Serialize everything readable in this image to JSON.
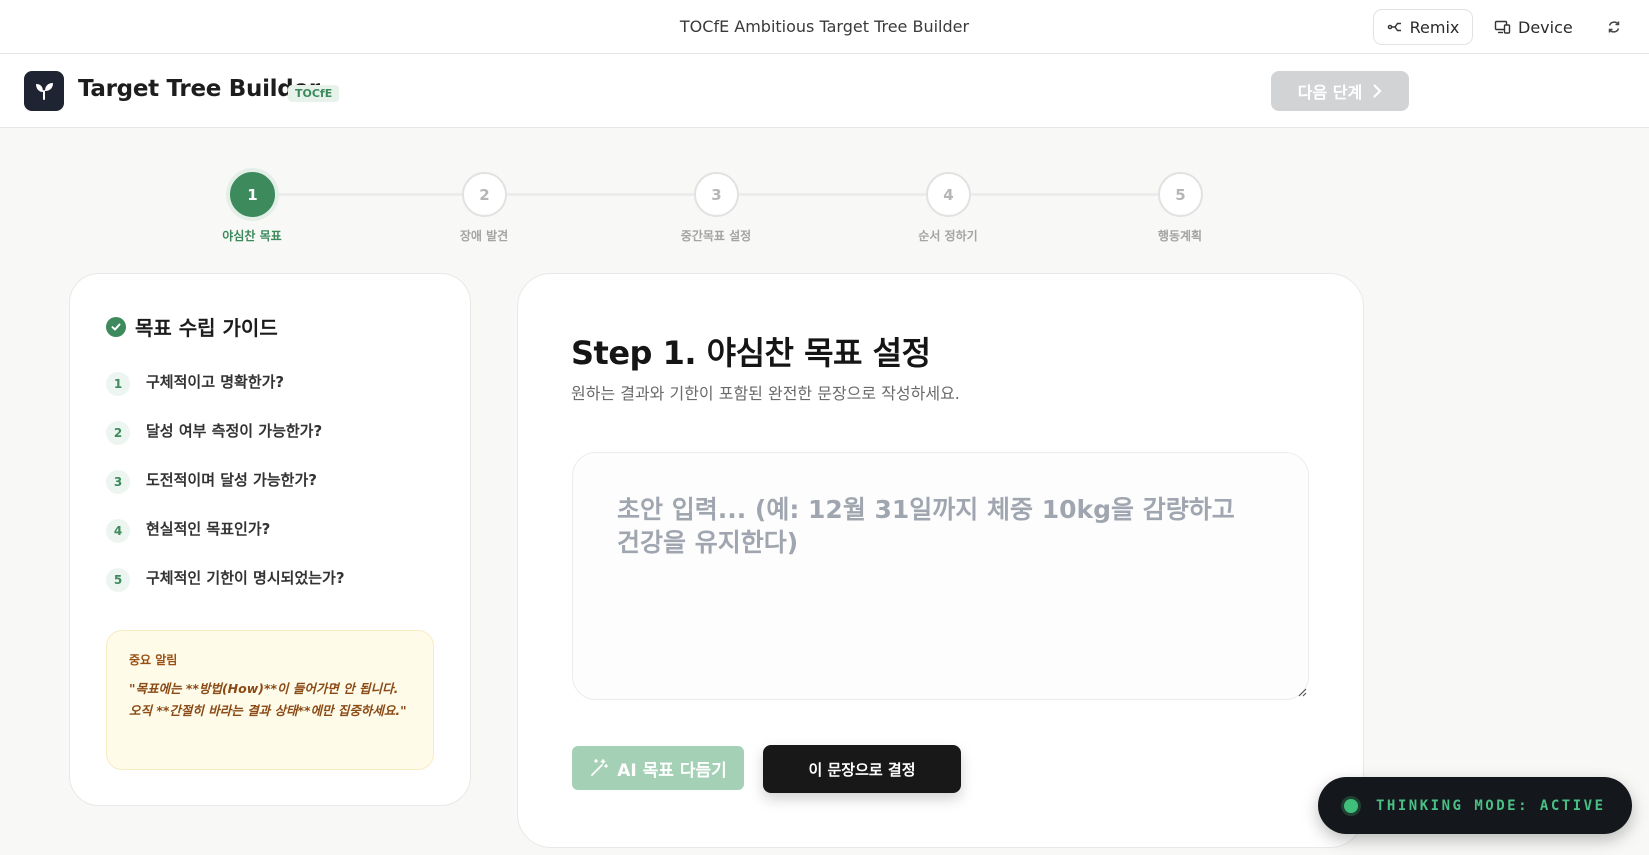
{
  "topbar": {
    "title": "TOCfE Ambitious Target Tree Builder",
    "remix_label": "Remix",
    "device_label": "Device"
  },
  "header": {
    "app_title": "Target Tree Builder",
    "badge": "TOCfE",
    "next_label": "다음 단계"
  },
  "stepper": {
    "steps": [
      {
        "number": "1",
        "label": "야심찬 목표"
      },
      {
        "number": "2",
        "label": "장애 발견"
      },
      {
        "number": "3",
        "label": "중간목표 설정"
      },
      {
        "number": "4",
        "label": "순서 정하기"
      },
      {
        "number": "5",
        "label": "행동계획"
      }
    ]
  },
  "guide": {
    "title": "목표 수립 가이드",
    "items": [
      {
        "number": "1",
        "text": "구체적이고 명확한가?"
      },
      {
        "number": "2",
        "text": "달성 여부 측정이 가능한가?"
      },
      {
        "number": "3",
        "text": "도전적이며 달성 가능한가?"
      },
      {
        "number": "4",
        "text": "현실적인 목표인가?"
      },
      {
        "number": "5",
        "text": "구체적인 기한이 명시되었는가?"
      }
    ],
    "notice_title": "중요 알림",
    "notice_body": "\"목표에는 **방법(How)**이 들어가면 안 됩니다. 오직 **간절히 바라는 결과 상태**에만 집중하세요.\""
  },
  "main": {
    "title": "Step 1. 야심찬 목표 설정",
    "subtitle": "원하는 결과와 기한이 포함된 완전한 문장으로 작성하세요.",
    "input_value": "",
    "input_placeholder": "초안 입력... (예: 12월 31일까지 체중 10kg을 감량하고 건강을 유지한다)",
    "ai_button_label": "AI 목표 다듬기",
    "confirm_button_label": "이 문장으로 결정"
  },
  "status": {
    "thinking_label": "THINKING MODE: ACTIVE"
  },
  "colors": {
    "accent": "#3d8a5d",
    "accent_light": "#a4d0b6",
    "dark": "#181818",
    "disabled": "#d2d3d5",
    "notice_bg": "#fefbe9"
  }
}
